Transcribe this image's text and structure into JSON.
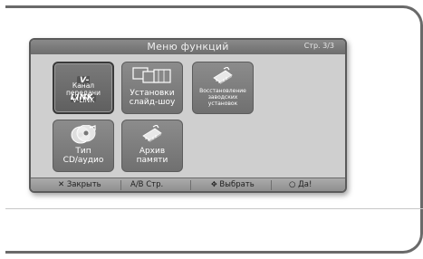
{
  "menu": {
    "title": "Меню функций",
    "page_indicator": "Стр. 3/3",
    "tiles": [
      {
        "badge": "V-LINK",
        "label": "Канал\nпередачи\nV-LINK",
        "icon": "v-link-logo-icon",
        "selected": true
      },
      {
        "label": "Установки\nслайд-шоу",
        "icon": "slideshow-frames-icon",
        "selected": false
      },
      {
        "label": "Восстановление\nзаводских\nустановок",
        "icon": "reset-chip-icon",
        "selected": false
      },
      {
        "label": "Тип\nCD/аудио",
        "icon": "cd-disc-icon",
        "selected": false
      },
      {
        "label": "Архив\nпамяти",
        "icon": "memory-chip-icon",
        "selected": false
      }
    ],
    "footer": {
      "close": "✕ Закрыть",
      "ab_page": "A/B Стр.",
      "select": "Выбрать",
      "ok": "○ Да!"
    }
  }
}
